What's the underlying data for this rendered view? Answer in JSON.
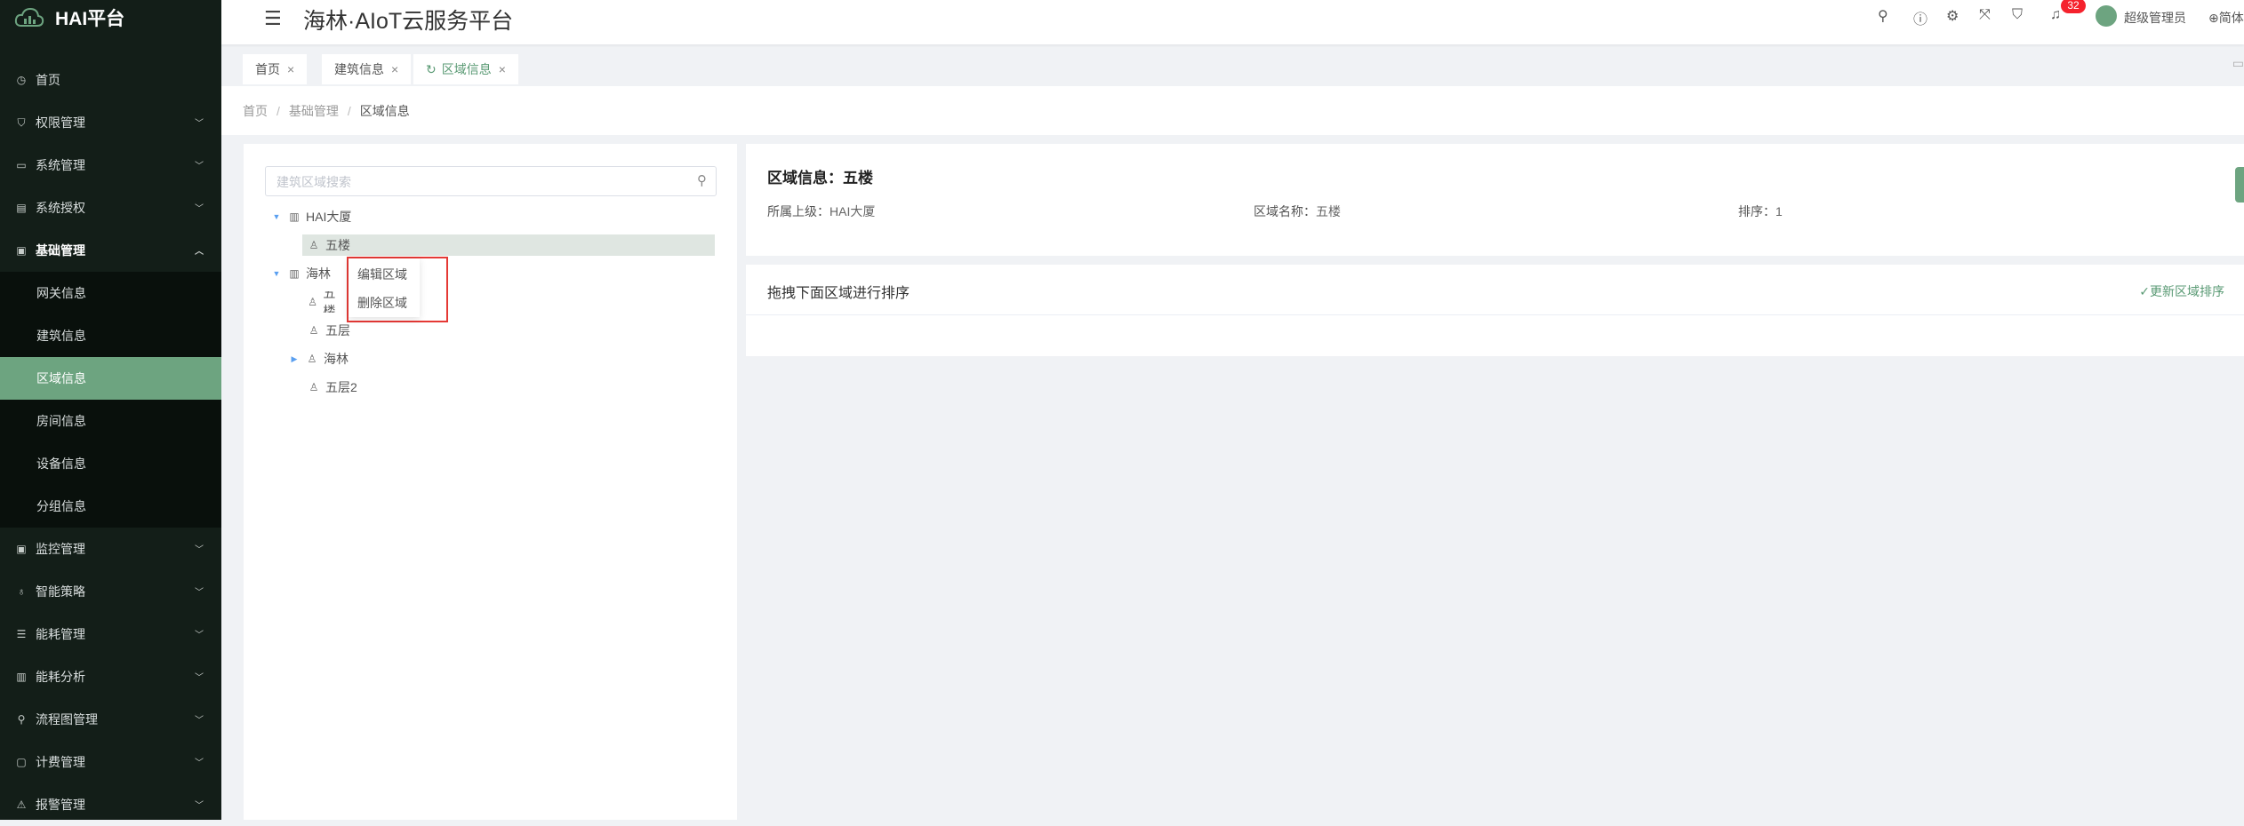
{
  "app": {
    "logo_text": "HAI平台",
    "title": "海林·AIoT云服务平台"
  },
  "sidebar": {
    "items": [
      {
        "icon": "◷",
        "label": "首页"
      },
      {
        "icon": "⛉",
        "label": "权限管理"
      },
      {
        "icon": "▭",
        "label": "系统管理"
      },
      {
        "icon": "▤",
        "label": "系统授权"
      },
      {
        "icon": "▣",
        "label": "基础管理"
      },
      {
        "icon": "▣",
        "label": "监控管理"
      },
      {
        "icon": "♁",
        "label": "智能策略"
      },
      {
        "icon": "☰",
        "label": "能耗管理"
      },
      {
        "icon": "▥",
        "label": "能耗分析"
      },
      {
        "icon": "⚲",
        "label": "流程图管理"
      },
      {
        "icon": "▢",
        "label": "计费管理"
      },
      {
        "icon": "⚠",
        "label": "报警管理"
      }
    ],
    "sub_items": [
      {
        "label": "网关信息"
      },
      {
        "label": "建筑信息"
      },
      {
        "label": "区域信息"
      },
      {
        "label": "房间信息"
      },
      {
        "label": "设备信息"
      },
      {
        "label": "分组信息"
      }
    ]
  },
  "header": {
    "notification_count": "32",
    "user_name": "超级管理员",
    "lang_label": "简体"
  },
  "tabs": [
    {
      "label": "首页"
    },
    {
      "label": "建筑信息"
    },
    {
      "label": "区域信息"
    }
  ],
  "breadcrumb": [
    "首页",
    "基础管理",
    "区域信息"
  ],
  "tree": {
    "search_placeholder": "建筑区域搜索",
    "nodes": [
      {
        "label": "HAI大厦"
      },
      {
        "label": "五楼"
      },
      {
        "label": "海林"
      },
      {
        "label": "五楼"
      },
      {
        "label": "五层"
      },
      {
        "label": "海林"
      },
      {
        "label": "五层2"
      }
    ]
  },
  "context_menu": {
    "edit": "编辑区域",
    "delete": "删除区域"
  },
  "info": {
    "title": "区域信息：五楼",
    "parent_label": "所属上级：",
    "parent_value": "HAI大厦",
    "name_label": "区域名称：",
    "name_value": "五楼",
    "order_label": "排序：",
    "order_value": "1"
  },
  "sort_panel": {
    "title": "拖拽下面区域进行排序",
    "update_label": "✓更新区域排序"
  },
  "colors": {
    "sidebar_bg": "#131e18",
    "accent": "#6da480",
    "badge": "#f5222d"
  }
}
